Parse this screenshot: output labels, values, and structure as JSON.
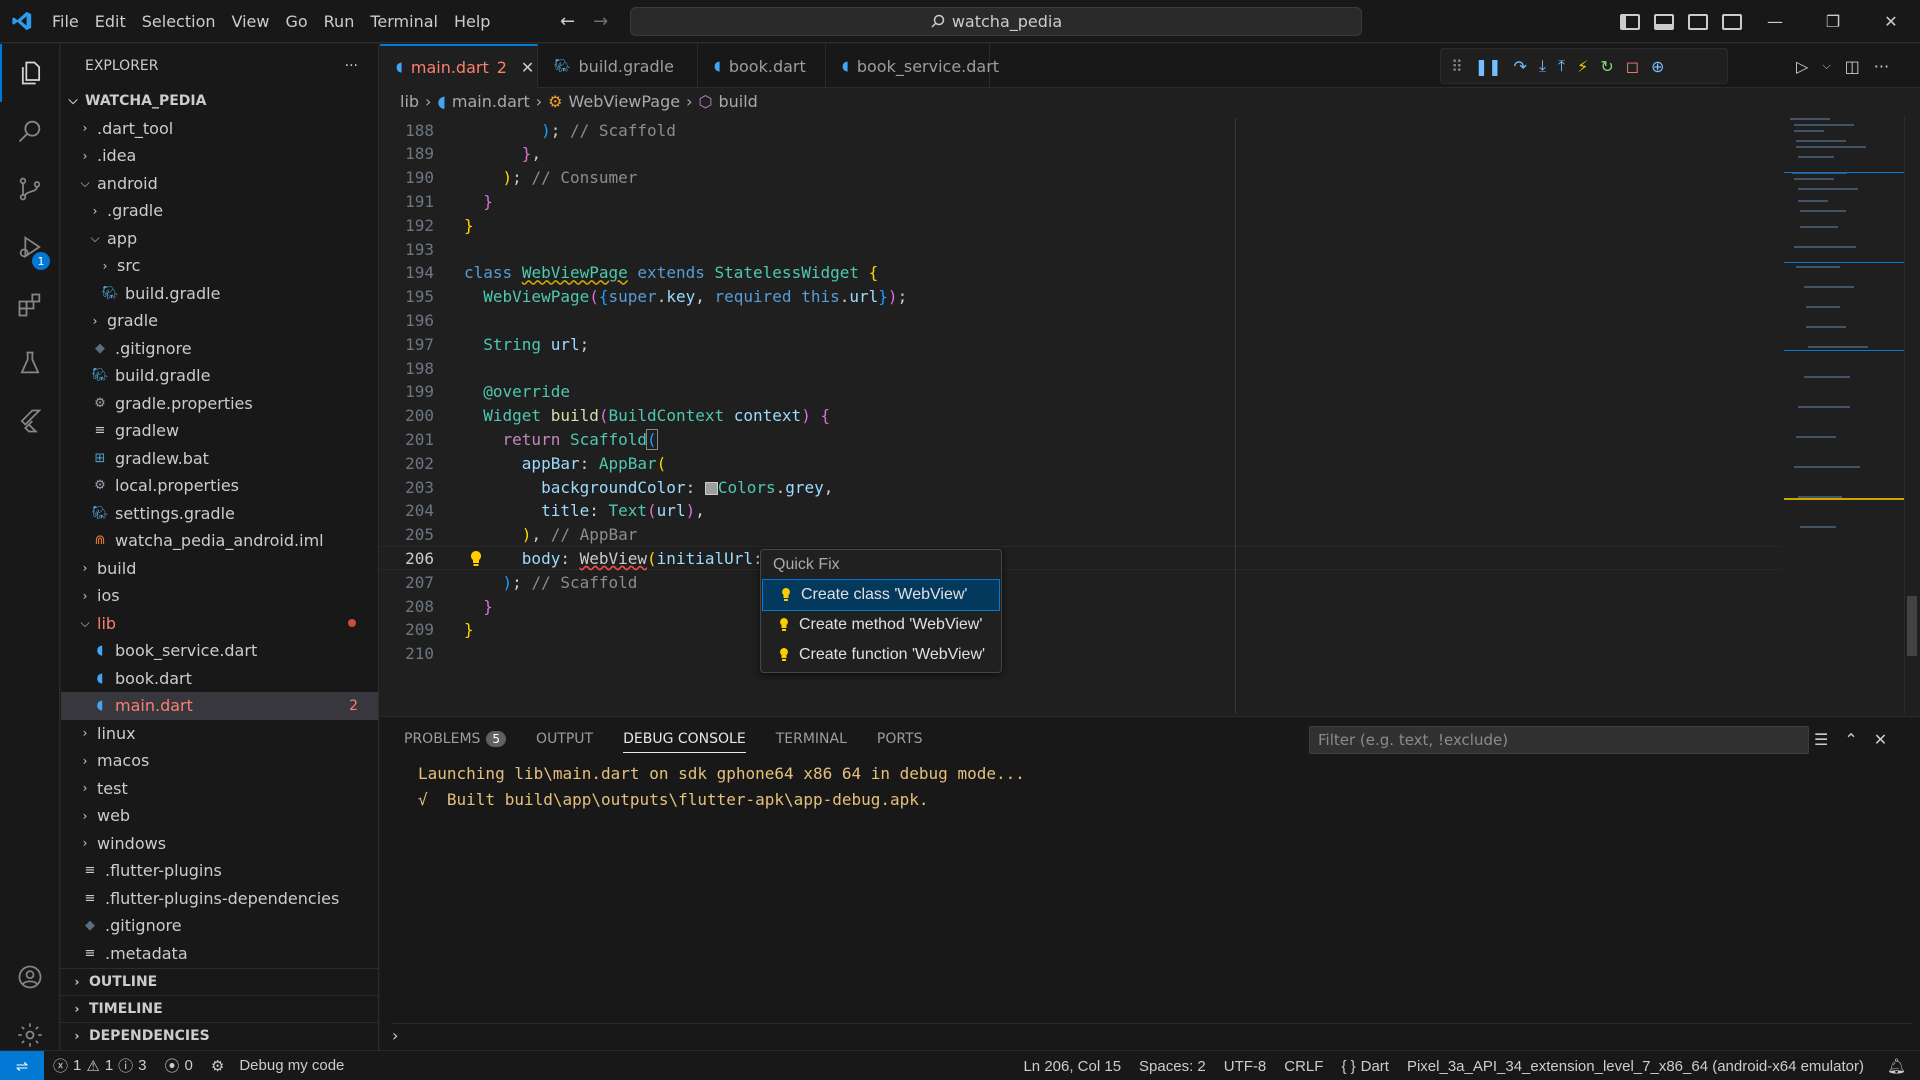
{
  "titlebar": {
    "menu": [
      "File",
      "Edit",
      "Selection",
      "View",
      "Go",
      "Run",
      "Terminal",
      "Help"
    ],
    "search": "watcha_pedia"
  },
  "activity": {
    "debug_badge": "1"
  },
  "explorer": {
    "title": "EXPLORER",
    "more": "···",
    "root": "WATCHA_PEDIA",
    "items": [
      {
        "label": ".dart_tool",
        "indent": 0,
        "kind": "folder",
        "open": false
      },
      {
        "label": ".idea",
        "indent": 0,
        "kind": "folder",
        "open": false
      },
      {
        "label": "android",
        "indent": 0,
        "kind": "folder",
        "open": true
      },
      {
        "label": ".gradle",
        "indent": 1,
        "kind": "folder",
        "open": false
      },
      {
        "label": "app",
        "indent": 1,
        "kind": "folder",
        "open": true
      },
      {
        "label": "src",
        "indent": 2,
        "kind": "folder",
        "open": false
      },
      {
        "label": "build.gradle",
        "indent": 2,
        "kind": "gradle"
      },
      {
        "label": "gradle",
        "indent": 1,
        "kind": "folder",
        "open": false
      },
      {
        "label": ".gitignore",
        "indent": 1,
        "kind": "git"
      },
      {
        "label": "build.gradle",
        "indent": 1,
        "kind": "gradle"
      },
      {
        "label": "gradle.properties",
        "indent": 1,
        "kind": "gear"
      },
      {
        "label": "gradlew",
        "indent": 1,
        "kind": "lines"
      },
      {
        "label": "gradlew.bat",
        "indent": 1,
        "kind": "windows"
      },
      {
        "label": "local.properties",
        "indent": 1,
        "kind": "gear"
      },
      {
        "label": "settings.gradle",
        "indent": 1,
        "kind": "gradle"
      },
      {
        "label": "watcha_pedia_android.iml",
        "indent": 1,
        "kind": "rss"
      },
      {
        "label": "build",
        "indent": 0,
        "kind": "folder",
        "open": false
      },
      {
        "label": "ios",
        "indent": 0,
        "kind": "folder",
        "open": false
      },
      {
        "label": "lib",
        "indent": 0,
        "kind": "folder",
        "open": true,
        "error": true
      },
      {
        "label": "book_service.dart",
        "indent": 1,
        "kind": "dart"
      },
      {
        "label": "book.dart",
        "indent": 1,
        "kind": "dart"
      },
      {
        "label": "main.dart",
        "indent": 1,
        "kind": "dart",
        "selected": true,
        "badge": "2"
      },
      {
        "label": "linux",
        "indent": 0,
        "kind": "folder",
        "open": false
      },
      {
        "label": "macos",
        "indent": 0,
        "kind": "folder",
        "open": false
      },
      {
        "label": "test",
        "indent": 0,
        "kind": "folder",
        "open": false
      },
      {
        "label": "web",
        "indent": 0,
        "kind": "folder",
        "open": false
      },
      {
        "label": "windows",
        "indent": 0,
        "kind": "folder",
        "open": false
      },
      {
        "label": ".flutter-plugins",
        "indent": 0,
        "kind": "lines"
      },
      {
        "label": ".flutter-plugins-dependencies",
        "indent": 0,
        "kind": "lines"
      },
      {
        "label": ".gitignore",
        "indent": 0,
        "kind": "git"
      },
      {
        "label": ".metadata",
        "indent": 0,
        "kind": "lines"
      }
    ],
    "sections": [
      "OUTLINE",
      "TIMELINE",
      "DEPENDENCIES"
    ]
  },
  "tabs": [
    {
      "label": "main.dart",
      "badge": "2",
      "active": true,
      "icon": "dart"
    },
    {
      "label": "build.gradle",
      "active": false,
      "icon": "gradle"
    },
    {
      "label": "book.dart",
      "active": false,
      "icon": "dart"
    },
    {
      "label": "book_service.dart",
      "active": false,
      "icon": "dart"
    }
  ],
  "breadcrumb": [
    "lib",
    "main.dart",
    "WebViewPage",
    "build"
  ],
  "editor": {
    "current_line": 206,
    "lines": [
      {
        "n": 188,
        "html": "        <span class='br3'>)</span>; <span class='cm'>// Scaffold</span>"
      },
      {
        "n": 189,
        "html": "      <span class='br2'>}</span>,"
      },
      {
        "n": 190,
        "html": "    <span class='br1'>)</span>; <span class='cm'>// Consumer</span>"
      },
      {
        "n": 191,
        "html": "  <span class='br2'>}</span>"
      },
      {
        "n": 192,
        "html": "<span class='br1'>}</span>"
      },
      {
        "n": 193,
        "html": ""
      },
      {
        "n": 194,
        "html": "<span class='k'>class</span> <span class='c squig-y'>WebViewPage</span> <span class='k'>extends</span> <span class='c'>StatelessWidget</span> <span class='br1'>{</span>"
      },
      {
        "n": 195,
        "html": "  <span class='c'>WebViewPage</span><span class='br2'>(</span><span class='br3'>{</span><span class='k'>super</span>.<span class='p'>key</span>, <span class='k'>required</span> <span class='k'>this</span>.<span class='p'>url</span><span class='br3'>}</span><span class='br2'>)</span>;"
      },
      {
        "n": 196,
        "html": ""
      },
      {
        "n": 197,
        "html": "  <span class='c'>String</span> <span class='p'>url</span>;"
      },
      {
        "n": 198,
        "html": ""
      },
      {
        "n": 199,
        "html": "  <span class='c'>@override</span>"
      },
      {
        "n": 200,
        "html": "  <span class='c'>Widget</span> <span class='f'>build</span><span class='br2'>(</span><span class='c'>BuildContext</span> <span class='p'>context</span><span class='br2'>)</span> <span class='br2'>{</span>"
      },
      {
        "n": 201,
        "html": "    <span class='kw2'>return</span> <span class='c'>Scaffold</span><span class='br3' style='outline:1px solid #888'>(</span>"
      },
      {
        "n": 202,
        "html": "      <span class='p'>appBar</span>: <span class='c'>AppBar</span><span class='br1'>(</span>"
      },
      {
        "n": 203,
        "html": "        <span class='p'>backgroundColor</span>: <span style='display:inline-block;width:13px;height:13px;background:#9e9e9e;border:1px solid #ccc;vertical-align:middle'></span><span class='c'>Colors</span>.<span class='p'>grey</span>,"
      },
      {
        "n": 204,
        "html": "        <span class='p'>title</span>: <span class='c'>Text</span><span class='br2'>(</span><span class='p'>url</span><span class='br2'>)</span>,"
      },
      {
        "n": 205,
        "html": "      <span class='br1'>)</span>, <span class='cm'>// AppBar</span>"
      },
      {
        "n": 206,
        "html": "      <span class='p'>body</span>: <span class='squig'>WebView</span><span class='br1'>(</span><span class='p'>initialUrl</span>:"
      },
      {
        "n": 207,
        "html": "    <span class='br3'>)</span>; <span class='cm'>// Scaffold</span>"
      },
      {
        "n": 208,
        "html": "  <span class='br2'>}</span>"
      },
      {
        "n": 209,
        "html": "<span class='br1'>}</span>"
      },
      {
        "n": 210,
        "html": ""
      }
    ]
  },
  "quickfix": {
    "title": "Quick Fix",
    "items": [
      "Create class 'WebView'",
      "Create method 'WebView'",
      "Create function 'WebView'"
    ]
  },
  "panel": {
    "tabs": [
      {
        "label": "PROBLEMS",
        "badge": "5"
      },
      {
        "label": "OUTPUT"
      },
      {
        "label": "DEBUG CONSOLE",
        "active": true
      },
      {
        "label": "TERMINAL"
      },
      {
        "label": "PORTS"
      }
    ],
    "filter_placeholder": "Filter (e.g. text, !exclude)",
    "console": [
      "Launching lib\\main.dart on sdk gphone64 x86 64 in debug mode...",
      "√  Built build\\app\\outputs\\flutter-apk\\app-debug.apk."
    ]
  },
  "status": {
    "errors": "1",
    "warnings": "1",
    "infos": "3",
    "ports": "0",
    "debug": "Debug my code",
    "position": "Ln 206, Col 15",
    "spaces": "Spaces: 2",
    "encoding": "UTF-8",
    "eol": "CRLF",
    "language": "Dart",
    "device": "Pixel_3a_API_34_extension_level_7_x86_64 (android-x64 emulator)"
  }
}
